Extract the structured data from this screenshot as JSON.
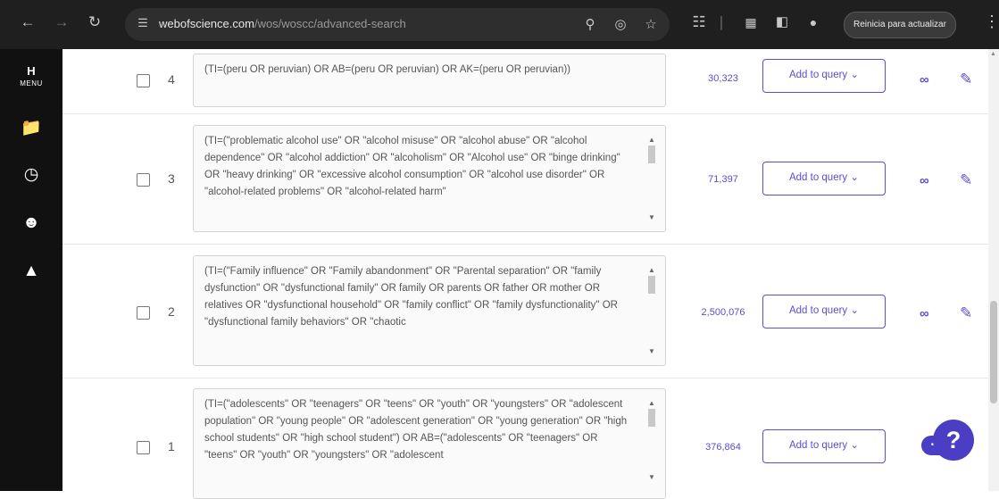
{
  "browser": {
    "url_host": "webofscience.com",
    "url_path": "/wos/woscc/advanced-search",
    "update_label": "Reinicia para actualizar",
    "icons": [
      "back-icon",
      "forward-icon",
      "reload-icon",
      "site-info-icon",
      "search-icon",
      "eye-off-icon",
      "star-icon",
      "extensions-icon",
      "translate-icon",
      "sidebar-icon",
      "profile-icon",
      "more-vert-icon"
    ]
  },
  "rail": {
    "menu_label": "MENU",
    "menu_glyph": "H",
    "icons": [
      "folder-icon",
      "history-icon",
      "user-icon",
      "bell-icon"
    ]
  },
  "rows": [
    {
      "num": "4",
      "query": "(TI=(peru OR peruvian) OR AB=(peru OR peruvian) OR AK=(peru OR peruvian))",
      "count": "30,323",
      "add_label": "Add to query"
    },
    {
      "num": "3",
      "query": "(TI=(\"problematic alcohol use\" OR \"alcohol misuse\" OR \"alcohol abuse\" OR \"alcohol dependence\" OR \"alcohol addiction\" OR \"alcoholism\" OR \"Alcohol use\" OR \"binge drinking\" OR \"heavy drinking\" OR \"excessive alcohol consumption\" OR \"alcohol use disorder\" OR \"alcohol-related problems\" OR \"alcohol-related harm\"",
      "count": "71,397",
      "add_label": "Add to query"
    },
    {
      "num": "2",
      "query": "(TI=(\"Family influence\" OR \"Family abandonment\" OR \"Parental separation\" OR \"family dysfunction\" OR \"dysfunctional family\" OR family OR parents OR father OR mother OR relatives OR \"dysfunctional household\" OR \"family conflict\" OR \"family dysfunctionality\" OR \"dysfunctional family behaviors\" OR \"chaotic",
      "count": "2,500,076",
      "add_label": "Add to query"
    },
    {
      "num": "1",
      "query": "(TI=(\"adolescents\" OR \"teenagers\" OR \"teens\" OR \"youth\" OR \"youngsters\" OR \"adolescent population\" OR \"young people\" OR \"adolescent generation\" OR \"young generation\" OR \"high school students\" OR \"high school student\") OR AB=(\"adolescents\" OR \"teenagers\" OR \"teens\" OR \"youth\" OR \"youngsters\" OR \"adolescent",
      "count": "376,864",
      "add_label": "Add to query"
    }
  ],
  "help": {
    "glyph": "?",
    "bubble": "•••"
  },
  "colors": {
    "accent": "#5a4fcf",
    "chrome": "#1f1f1f",
    "rail": "#111111"
  }
}
